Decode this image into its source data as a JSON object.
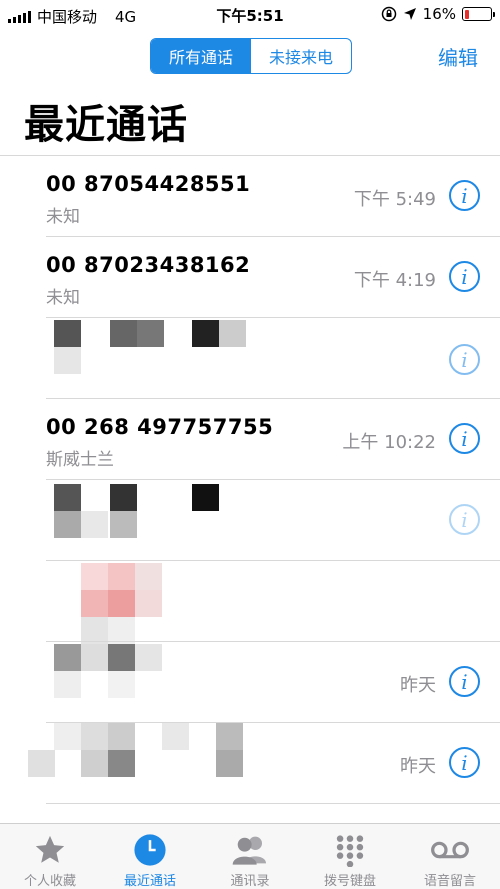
{
  "status": {
    "carrier": "中国移动",
    "network": "4G",
    "time": "下午5:51",
    "battery": "16%",
    "battery_level": 0.16
  },
  "nav": {
    "segments": [
      "所有通话",
      "未接来电"
    ],
    "edit": "编辑"
  },
  "title": "最近通话",
  "calls": [
    {
      "name": "00 87054428551",
      "sub": "未知",
      "time": "下午 5:49"
    },
    {
      "name": "00 87023438162",
      "sub": "未知",
      "time": "下午 4:19"
    },
    {
      "name": "",
      "sub": "",
      "time": ""
    },
    {
      "name": "00 268 497757755",
      "sub": "斯威士兰",
      "time": "上午 10:22"
    },
    {
      "name": "",
      "sub": "",
      "time": ""
    },
    {
      "name": "",
      "sub": "",
      "time": ""
    },
    {
      "name": "",
      "sub": "",
      "time": "昨天"
    },
    {
      "name": "",
      "sub": "",
      "time": "昨天"
    }
  ],
  "tabs": [
    {
      "label": "个人收藏",
      "icon": "star-icon"
    },
    {
      "label": "最近通话",
      "icon": "clock-icon"
    },
    {
      "label": "通讯录",
      "icon": "contacts-icon"
    },
    {
      "label": "拨号键盘",
      "icon": "keypad-icon"
    },
    {
      "label": "语音留言",
      "icon": "voicemail-icon"
    }
  ],
  "colors": {
    "accent": "#1e88e5",
    "battery_low": "#e5302d"
  }
}
